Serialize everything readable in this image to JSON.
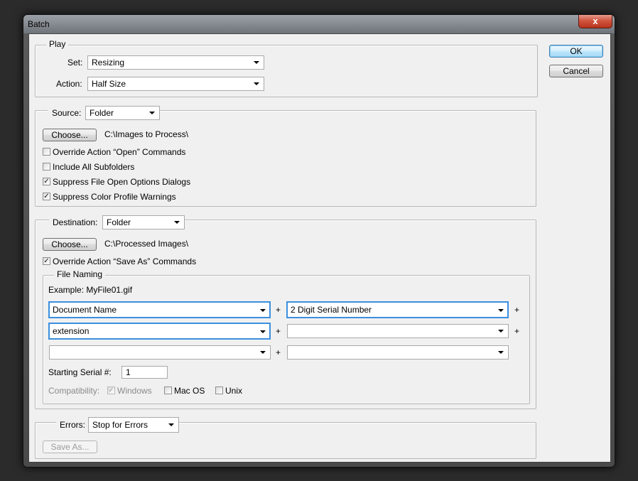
{
  "window": {
    "title": "Batch",
    "close_glyph": "x"
  },
  "buttons": {
    "ok": "OK",
    "cancel": "Cancel"
  },
  "play": {
    "legend": "Play",
    "set_label": "Set:",
    "set_value": "Resizing",
    "action_label": "Action:",
    "action_value": "Half Size"
  },
  "source": {
    "label": "Source:",
    "value": "Folder",
    "choose": "Choose...",
    "path": "C:\\Images to Process\\",
    "options": [
      {
        "label": "Override Action “Open” Commands",
        "checked": false
      },
      {
        "label": "Include All Subfolders",
        "checked": false
      },
      {
        "label": "Suppress File Open Options Dialogs",
        "checked": true
      },
      {
        "label": "Suppress Color Profile Warnings",
        "checked": true
      }
    ]
  },
  "destination": {
    "label": "Destination:",
    "value": "Folder",
    "choose": "Choose...",
    "path": "C:\\Processed Images\\",
    "override_label": "Override Action “Save As” Commands",
    "override_checked": true,
    "file_naming": {
      "legend": "File Naming",
      "example": "Example: MyFile01.gif",
      "fields": [
        {
          "left": "Document Name",
          "right": "2 Digit Serial Number"
        },
        {
          "left": "extension",
          "right": ""
        },
        {
          "left": "",
          "right": ""
        }
      ],
      "plus": "+",
      "serial_label": "Starting Serial #:",
      "serial_value": "1",
      "compat_label": "Compatibility:",
      "compat": [
        {
          "label": "Windows",
          "checked": true,
          "disabled": true
        },
        {
          "label": "Mac OS",
          "checked": false,
          "disabled": false
        },
        {
          "label": "Unix",
          "checked": false,
          "disabled": false
        }
      ]
    }
  },
  "errors": {
    "label": "Errors:",
    "value": "Stop for Errors",
    "save_as": "Save As..."
  },
  "checkmark": "✓"
}
